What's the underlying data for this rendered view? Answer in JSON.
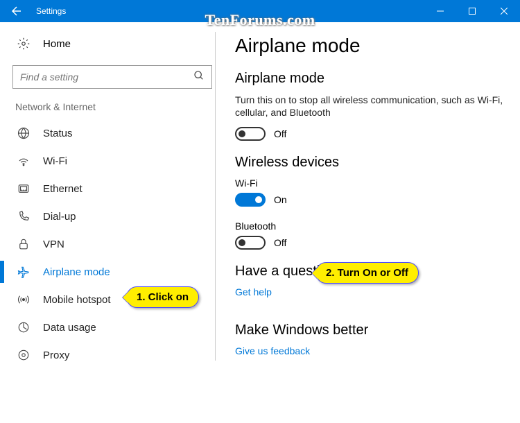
{
  "window": {
    "title": "Settings"
  },
  "watermark": "TenForums.com",
  "sidebar": {
    "home": "Home",
    "search_placeholder": "Find a setting",
    "group": "Network & Internet",
    "items": [
      {
        "label": "Status"
      },
      {
        "label": "Wi-Fi"
      },
      {
        "label": "Ethernet"
      },
      {
        "label": "Dial-up"
      },
      {
        "label": "VPN"
      },
      {
        "label": "Airplane mode"
      },
      {
        "label": "Mobile hotspot"
      },
      {
        "label": "Data usage"
      },
      {
        "label": "Proxy"
      }
    ]
  },
  "content": {
    "title": "Airplane mode",
    "airplane": {
      "heading": "Airplane mode",
      "desc": "Turn this on to stop all wireless communication, such as Wi-Fi, cellular, and Bluetooth",
      "state": "Off"
    },
    "wireless": {
      "heading": "Wireless devices",
      "wifi_label": "Wi-Fi",
      "wifi_state": "On",
      "bt_label": "Bluetooth",
      "bt_state": "Off"
    },
    "question": {
      "heading": "Have a question?",
      "link": "Get help"
    },
    "better": {
      "heading": "Make Windows better",
      "link": "Give us feedback"
    }
  },
  "callouts": {
    "c1": "1. Click on",
    "c2": "2. Turn On or Off"
  }
}
